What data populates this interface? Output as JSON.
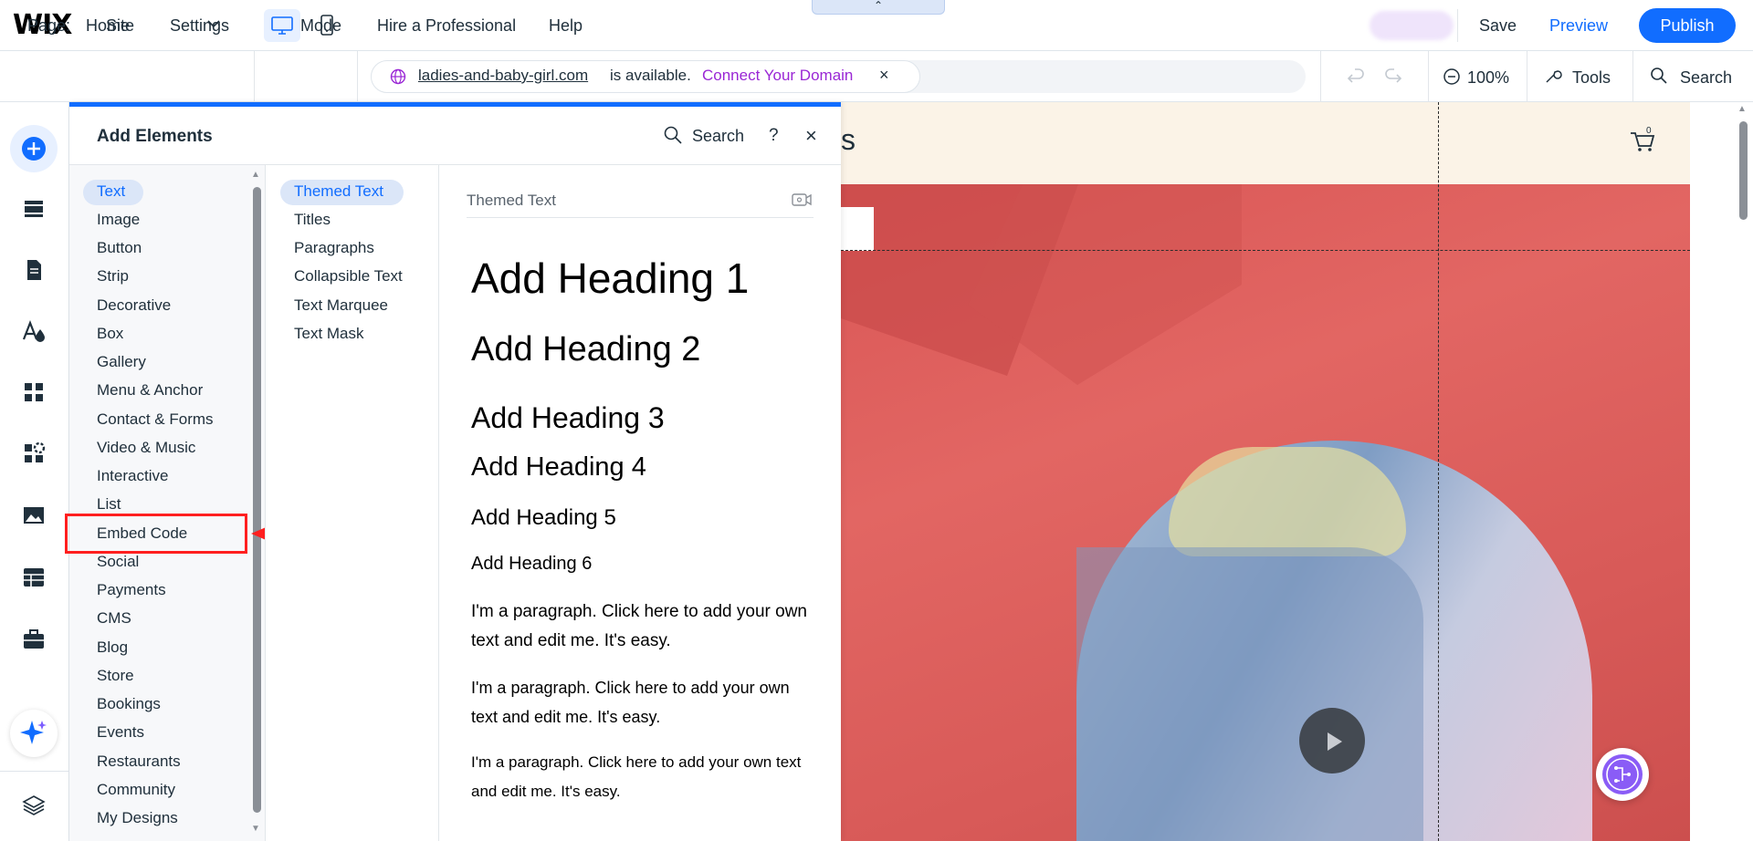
{
  "topbar": {
    "logo": "WIX",
    "menu": [
      "Site",
      "Settings",
      "Dev Mode",
      "Hire a Professional",
      "Help"
    ],
    "save": "Save",
    "preview": "Preview",
    "publish": "Publish",
    "handle_glyph": "⌃"
  },
  "secondbar": {
    "page_label": "Page:",
    "page_value": "Home",
    "domain_name": "ladies-and-baby-girl.com",
    "domain_status": "is available.",
    "domain_cta": "Connect Your Domain",
    "domain_close": "×",
    "zoom": "100%",
    "tools": "Tools",
    "search": "Search"
  },
  "panel": {
    "title": "Add Elements",
    "search": "Search",
    "help": "?",
    "close": "×",
    "categories": [
      "Text",
      "Image",
      "Button",
      "Strip",
      "Decorative",
      "Box",
      "Gallery",
      "Menu & Anchor",
      "Contact & Forms",
      "Video & Music",
      "Interactive",
      "List",
      "Embed Code",
      "Social",
      "Payments",
      "CMS",
      "Blog",
      "Store",
      "Bookings",
      "Events",
      "Restaurants",
      "Community",
      "My Designs"
    ],
    "subcategories": [
      "Themed Text",
      "Titles",
      "Paragraphs",
      "Collapsible Text",
      "Text Marquee",
      "Text Mask"
    ],
    "section_label": "Themed Text",
    "headings": [
      "Add Heading 1",
      "Add Heading 2",
      "Add Heading 3",
      "Add Heading 4",
      "Add Heading 5",
      "Add Heading 6"
    ],
    "paragraphs": [
      [
        "I'm a paragraph. Click here to add your own",
        "text and edit me. It's easy."
      ],
      [
        "I'm a paragraph. Click here to add your own",
        "text and edit me. It's easy."
      ],
      [
        "I'm a paragraph. Click here to add your own text",
        "and edit me. It's easy."
      ]
    ]
  },
  "canvas": {
    "header_text": "s",
    "cart_count": "0"
  },
  "colors": {
    "accent": "#116dff",
    "connect": "#9a27d5",
    "highlight": "#ff1f1f",
    "hero": "#d95655"
  },
  "icons": [
    "desktop-icon",
    "mobile-icon",
    "globe-icon",
    "undo-icon",
    "redo-icon",
    "zoom-out-icon",
    "tools-icon",
    "search-icon",
    "add-icon",
    "sections-icon",
    "pages-icon",
    "theme-icon",
    "apps-icon",
    "business-icon",
    "media-icon",
    "cms-icon",
    "portfolio-icon",
    "ai-assistant-icon",
    "layers-icon",
    "cart-icon",
    "play-icon"
  ]
}
